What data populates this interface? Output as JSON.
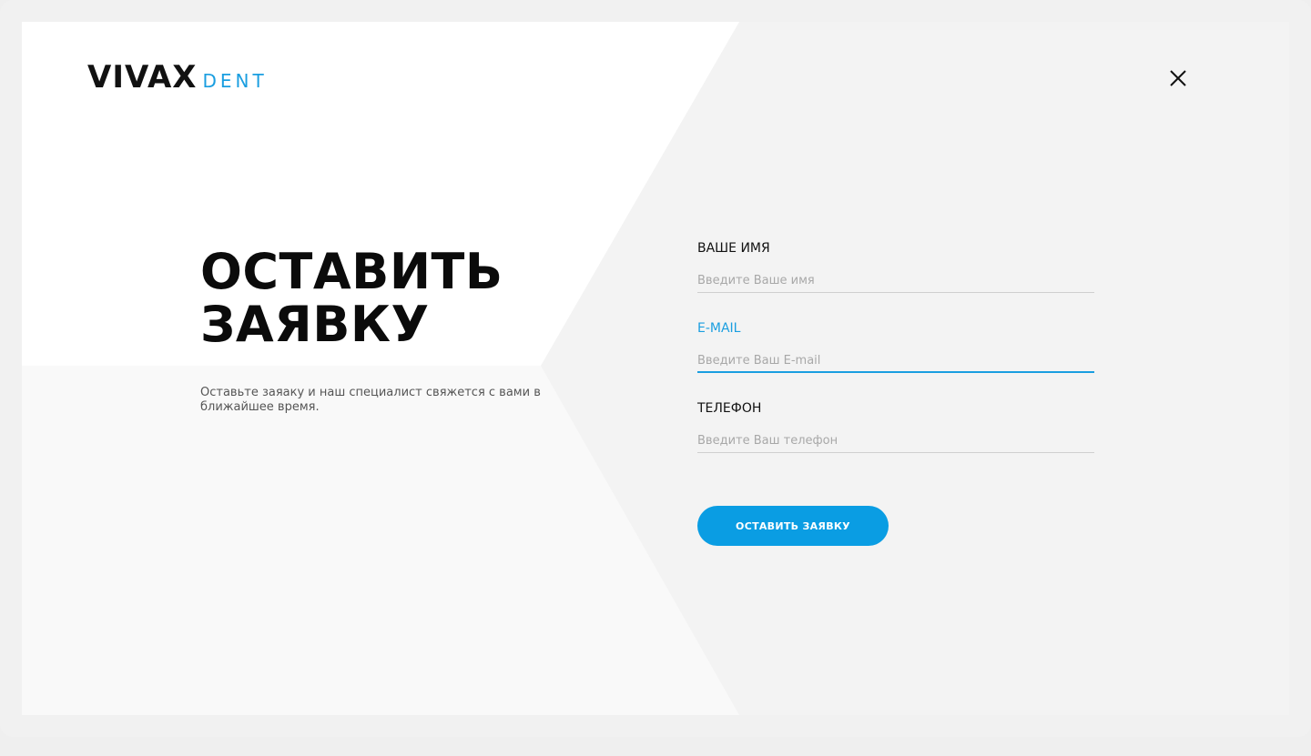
{
  "logo": {
    "main": "VIVAX",
    "sub": "DENT"
  },
  "close": {
    "icon": "close-icon"
  },
  "heading": {
    "line1": "ОСТАВИТЬ",
    "line2": "ЗАЯВКУ"
  },
  "subtitle": "Оставьте заяаку и наш специалист свяжется с вами в ближайшее время.",
  "form": {
    "name": {
      "label": "ВАШЕ ИМЯ",
      "placeholder": "Введите Ваше имя"
    },
    "email": {
      "label": "E-MAIL",
      "placeholder": "Введите Ваш E-mail"
    },
    "phone": {
      "label": "ТЕЛЕФОН",
      "placeholder": "Введите Ваш телефон"
    }
  },
  "submit_label": "ОСТАВИТЬ ЗАЯВКУ",
  "colors": {
    "accent": "#0a9de3",
    "text": "#111111",
    "placeholder": "#a8a8a8"
  }
}
